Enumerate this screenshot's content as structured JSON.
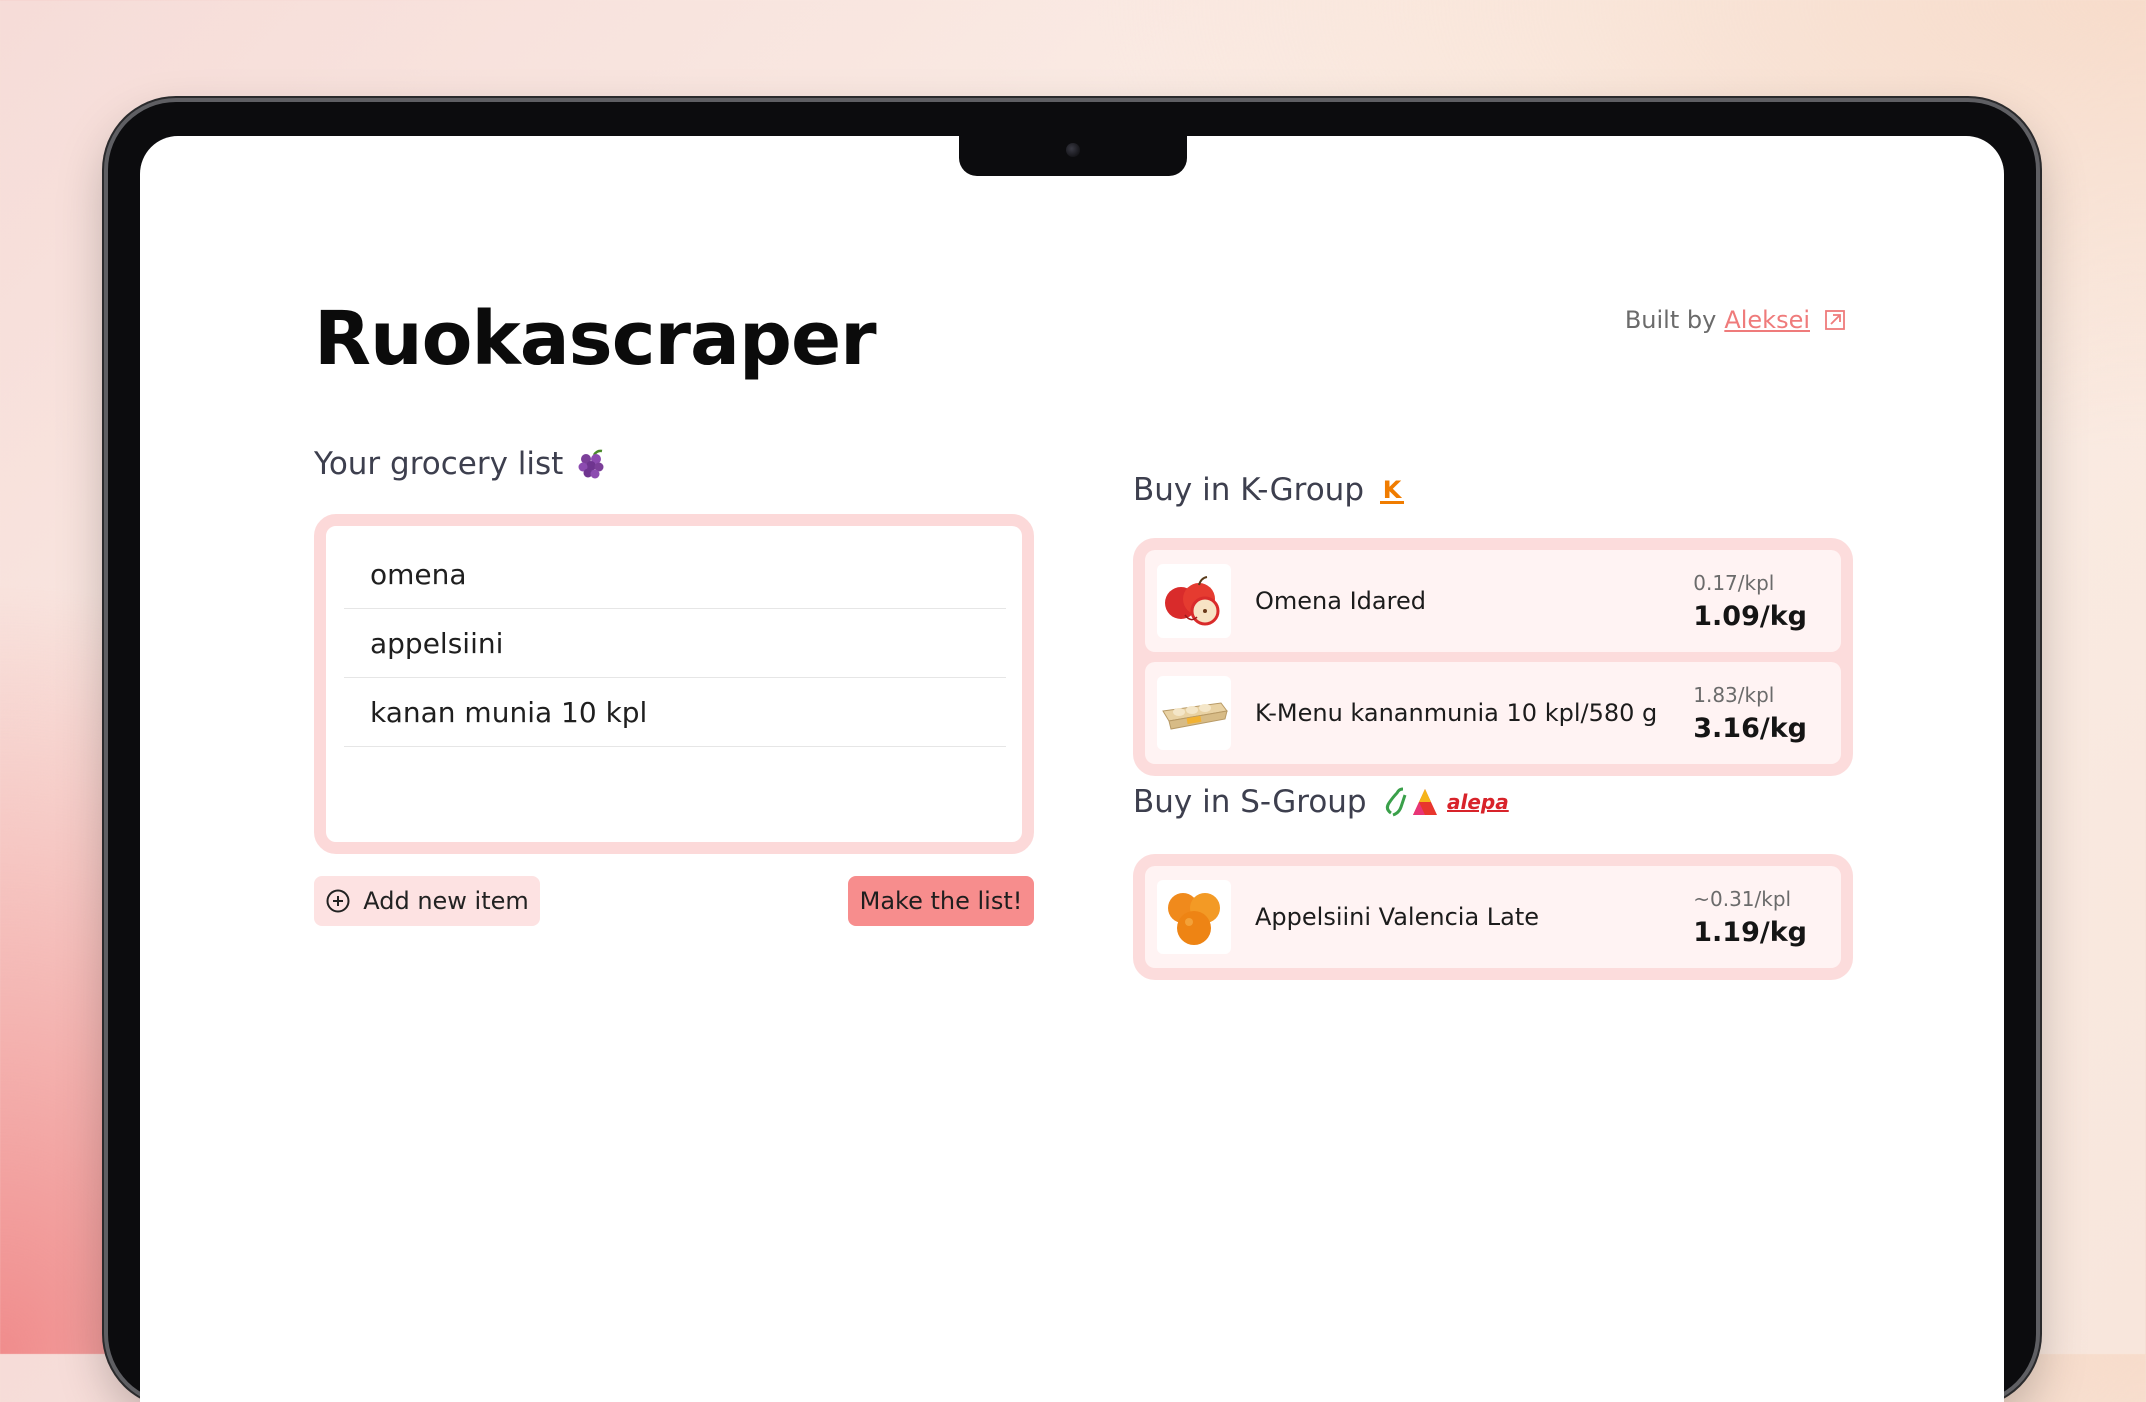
{
  "app": {
    "title": "Ruokascraper"
  },
  "credit": {
    "prefix": "Built by",
    "author": "Aleksei"
  },
  "grocery": {
    "title": "Your grocery list",
    "items": [
      "omena",
      "appelsiini",
      "kanan munia 10 kpl"
    ],
    "add_label": "Add new item",
    "make_label": "Make the list!"
  },
  "k_group": {
    "title": "Buy in K-Group",
    "logo_letter": "K",
    "items": [
      {
        "name": "Omena Idared",
        "unit_price": "0.17/kpl",
        "price": "1.09/kg",
        "icon": "apple-icon"
      },
      {
        "name": "K-Menu kananmunia 10 kpl/580 g",
        "unit_price": "1.83/kpl",
        "price": "3.16/kg",
        "icon": "egg-carton-icon"
      }
    ]
  },
  "s_group": {
    "title": "Buy in S-Group",
    "logo_text": "alepa",
    "items": [
      {
        "name": "Appelsiini Valencia Late",
        "unit_price": "~0.31/kpl",
        "price": "1.19/kg",
        "icon": "orange-icon"
      }
    ]
  },
  "colors": {
    "accent": "#f78d8d",
    "accent_light": "#fcdcdc",
    "link": "#ef7b7b",
    "k_orange": "#f07c00",
    "s_green": "#3aa04a"
  }
}
